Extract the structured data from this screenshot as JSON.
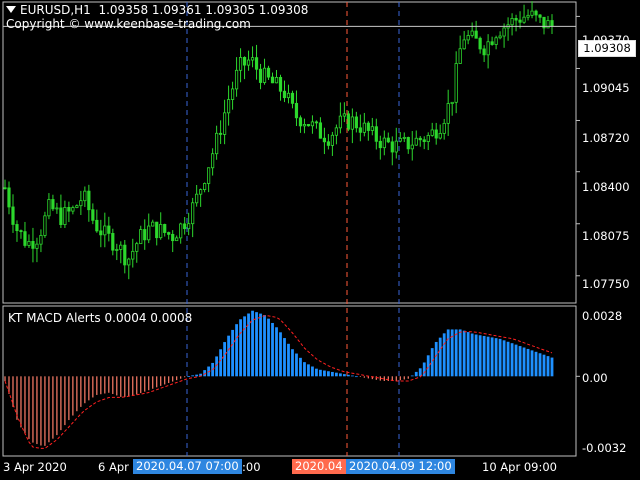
{
  "header": {
    "symbol": "EURUSD,H1",
    "ohlc": "1.09358 1.09361 1.09305 1.09308",
    "copyright": "Copyright © www.keenbase-trading.com"
  },
  "indicator": {
    "label": "KT MACD Alerts 0.0004 0.0008",
    "y_labels": [
      "0.0028",
      "0.00",
      "-0.0032"
    ]
  },
  "price_axis": {
    "labels": [
      "1.09370",
      "1.09045",
      "1.08720",
      "1.08400",
      "1.08075",
      "1.07750"
    ],
    "current_price": "1.09308"
  },
  "time_axis": {
    "labels": [
      "3 Apr 2020",
      "6 Apr",
      ":00",
      "10 Apr 09:00"
    ],
    "badges": [
      {
        "text": "2020.04.07 07:00",
        "color": "#2e86e0"
      },
      {
        "text": "2020.04",
        "color": "#ff6a4d"
      },
      {
        "text": "2020.04.09 12:00",
        "color": "#2e86e0"
      }
    ]
  },
  "colors": {
    "candle": "#2dd82d",
    "macd_up": "#1e90ff",
    "macd_down": "#ff7f6a",
    "signal": "#ff2020",
    "vline_blue": "#3a66d8",
    "vline_red": "#ff5a3a",
    "frame": "#bfbfbf"
  },
  "chart_data": {
    "type": "line",
    "instrument": "EURUSD",
    "timeframe": "H1",
    "price_range": [
      1.0758,
      1.0946
    ],
    "close_profile": [
      1.083,
      1.0805,
      1.0795,
      1.08,
      1.0818,
      1.0812,
      1.0815,
      1.0825,
      1.0808,
      1.08,
      1.0795,
      1.0785,
      1.0798,
      1.0805,
      1.0803,
      1.08,
      1.0808,
      1.082,
      1.084,
      1.086,
      1.0885,
      1.0905,
      1.091,
      1.09,
      1.0895,
      1.089,
      1.0875,
      1.0872,
      1.0865,
      1.0862,
      1.087,
      1.0872,
      1.0868,
      1.0862,
      1.0858,
      1.0856,
      1.0857,
      1.086,
      1.0862,
      1.087,
      1.0885,
      1.0925,
      1.0922,
      1.0918,
      1.0928,
      1.0932,
      1.0936,
      1.0938,
      1.0933,
      1.0931
    ],
    "macd_range": [
      -0.0034,
      0.003
    ],
    "macd_profile": [
      -0.0002,
      -0.002,
      -0.0028,
      -0.003,
      -0.0025,
      -0.0018,
      -0.0012,
      -0.0008,
      -0.0007,
      -0.0009,
      -0.0008,
      -0.0006,
      -0.0004,
      -0.0002,
      0.0,
      0.0001,
      0.0006,
      0.0016,
      0.0024,
      0.0028,
      0.0026,
      0.002,
      0.0012,
      0.0006,
      0.0003,
      0.0002,
      0.0001,
      0.0,
      -0.0001,
      -0.0002,
      -0.0002,
      -0.0001,
      0.0004,
      0.0014,
      0.002,
      0.002,
      0.0018,
      0.0017,
      0.0016,
      0.0014,
      0.0012,
      0.001,
      0.0008
    ],
    "signal_profile": [
      -0.0002,
      -0.0018,
      -0.003,
      -0.0031,
      -0.0027,
      -0.0021,
      -0.0015,
      -0.0011,
      -0.0009,
      -0.0009,
      -0.0008,
      -0.0007,
      -0.0005,
      -0.0003,
      -0.0001,
      0.0,
      0.0003,
      0.001,
      0.0018,
      0.0024,
      0.0026,
      0.0025,
      0.0019,
      0.0012,
      0.0007,
      0.0004,
      0.0002,
      0.0001,
      0.0,
      -0.0001,
      -0.0002,
      -0.0002,
      0.0,
      0.0008,
      0.0016,
      0.0019,
      0.0019,
      0.0018,
      0.0017,
      0.0016,
      0.0014,
      0.0012,
      0.001
    ]
  }
}
